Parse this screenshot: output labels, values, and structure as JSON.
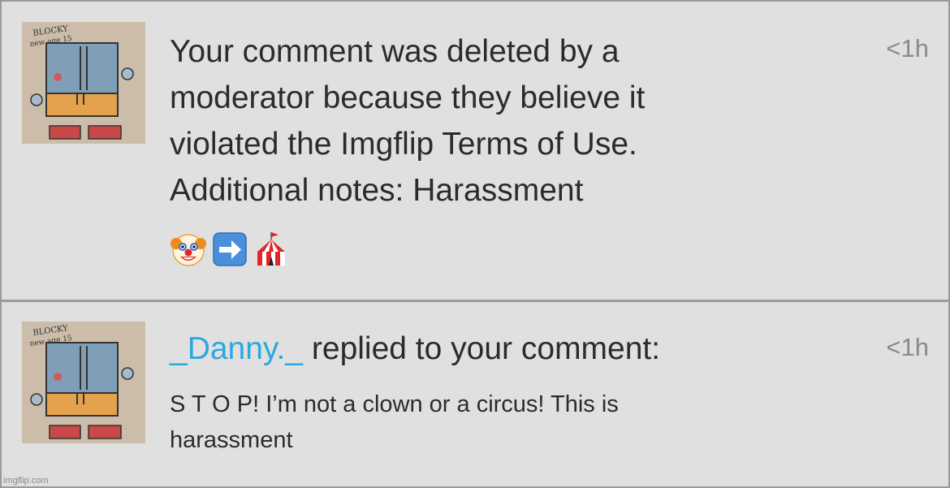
{
  "notifications": [
    {
      "time": "<1h",
      "lines": [
        "Your comment was deleted by a",
        "moderator because they believe it",
        "violated the Imgflip Terms of Use.",
        "Additional notes: Harassment"
      ],
      "emojis": [
        "clown-face-icon",
        "right-arrow-icon",
        "circus-tent-icon"
      ]
    },
    {
      "time": "<1h",
      "username": "_Danny._",
      "action": " replied to your comment:",
      "body_lines": [
        "S T O P! I’m not a clown or a circus! This is",
        "harassment"
      ]
    }
  ],
  "avatar_text": "BLOCKY new age 15",
  "watermark": "imgflip.com",
  "colors": {
    "background": "#e0e0e0",
    "border": "#9a9a9a",
    "text": "#2b2b2b",
    "time": "#8a8a8a",
    "username": "#2aa9e0"
  }
}
